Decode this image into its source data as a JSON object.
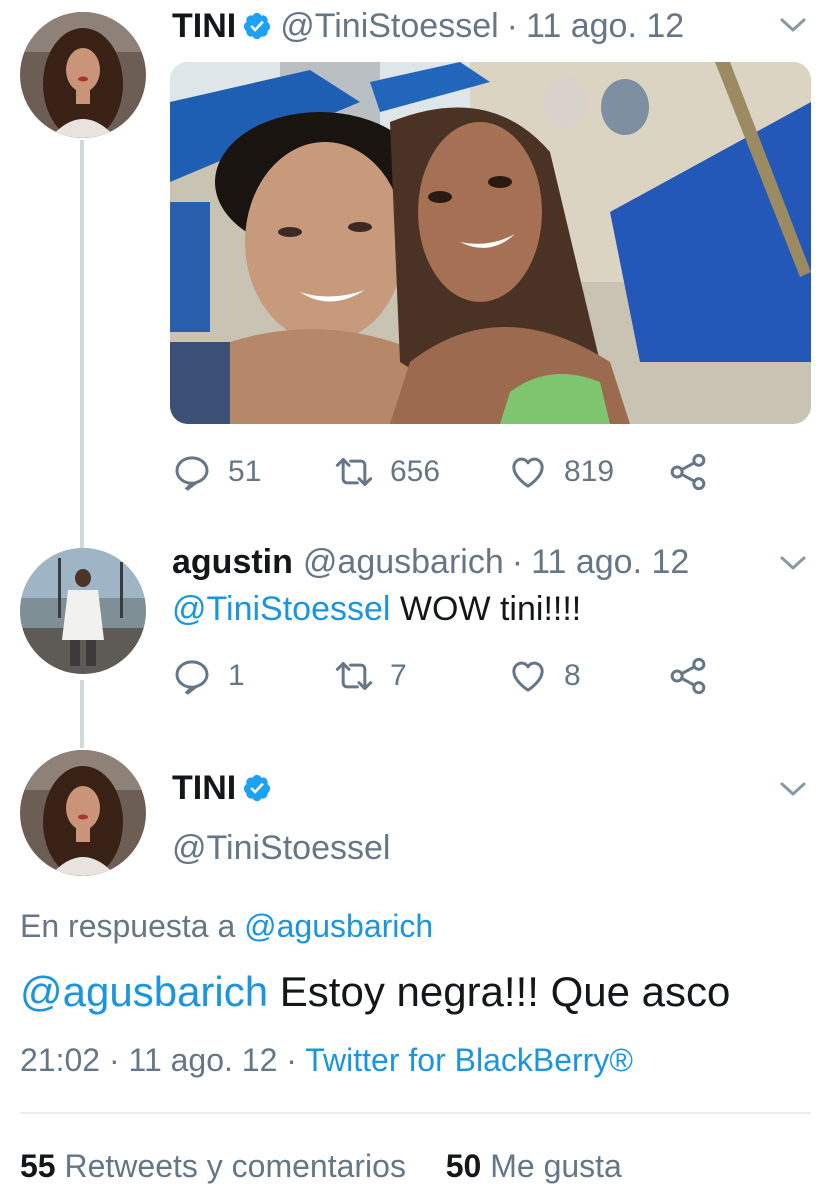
{
  "colors": {
    "link": "#1b95e0",
    "secondary_text": "#657786",
    "primary_text": "#14171a",
    "verified": "#1da1f2",
    "thread_line": "#cfd9de"
  },
  "tweet1": {
    "name": "TINI",
    "verified_icon": "verified-badge-icon",
    "handle": "@TiniStoessel",
    "dot": "·",
    "date": "11 ago. 12",
    "menu_icon": "chevron-down-icon",
    "media": "photo of a smiling couple taking a selfie on a beach",
    "actions": {
      "reply_count": "51",
      "retweet_count": "656",
      "like_count": "819"
    }
  },
  "tweet2": {
    "name": "agustin",
    "handle": "@agusbarich",
    "dot": "·",
    "date": "11 ago. 12",
    "menu_icon": "chevron-down-icon",
    "mention": "@TiniStoessel",
    "text": "WOW tini!!!!",
    "actions": {
      "reply_count": "1",
      "retweet_count": "7",
      "like_count": "8"
    }
  },
  "tweet3": {
    "name": "TINI",
    "verified_icon": "verified-badge-icon",
    "handle": "@TiniStoessel",
    "menu_icon": "chevron-down-icon",
    "reply_prefix": "En respuesta a",
    "reply_to": "@agusbarich",
    "mention": "@agusbarich",
    "text": "Estoy negra!!! Que asco",
    "time": "21:02",
    "sep1": "·",
    "date": "11 ago. 12",
    "sep2": "·",
    "source": "Twitter for BlackBerry®",
    "stats": {
      "retweets_count": "55",
      "retweets_label": "Retweets y comentarios",
      "likes_count": "50",
      "likes_label": "Me gusta"
    }
  }
}
